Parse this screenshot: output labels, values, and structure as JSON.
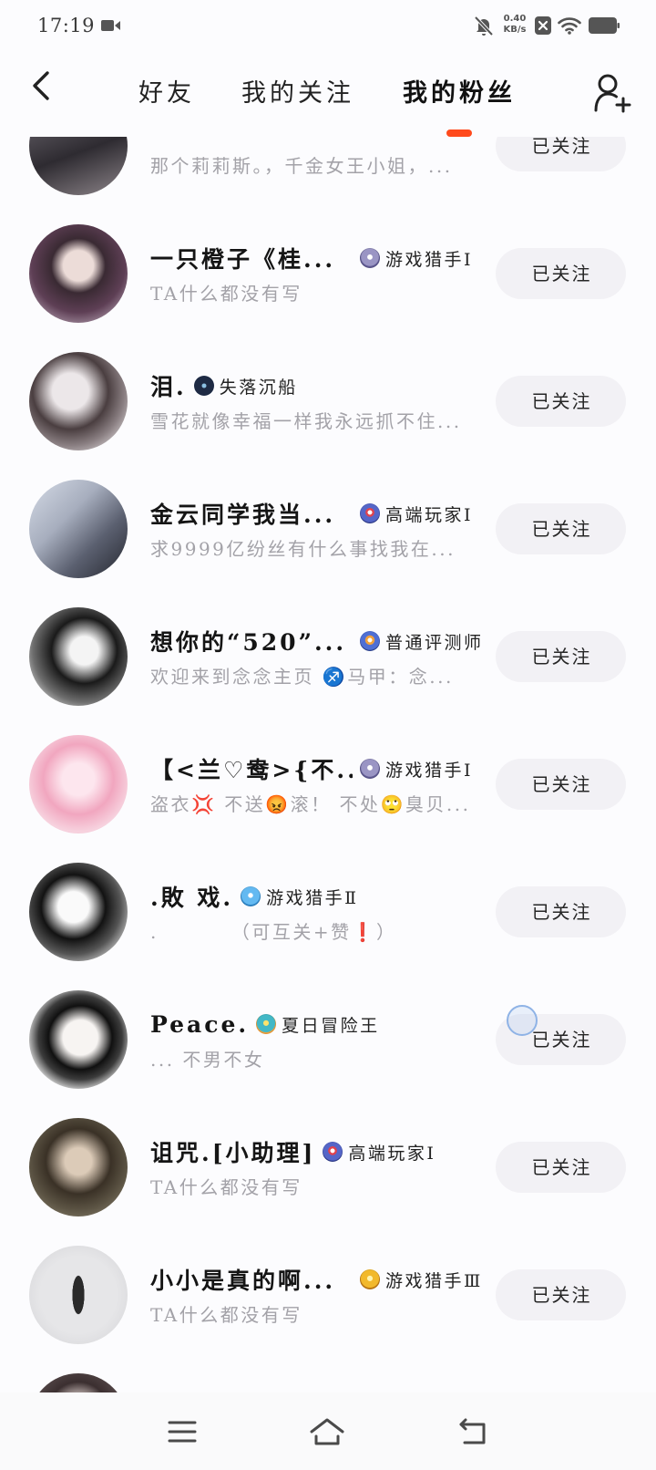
{
  "status_bar": {
    "time": "17:19",
    "net_speed_value": "0.40",
    "net_speed_unit": "KB/s",
    "icons": [
      "video-camera-icon",
      "bell-off-icon",
      "sim-disabled-icon",
      "wifi-icon",
      "battery-icon"
    ]
  },
  "header": {
    "back_icon": "chevron-left-icon",
    "tabs": [
      {
        "label": "好友",
        "selected": false
      },
      {
        "label": "我的关注",
        "selected": false
      },
      {
        "label": "我的粉丝",
        "selected": true
      }
    ],
    "add_icon": "add-user-icon",
    "indicator_color": "#ff4a1c"
  },
  "fans": [
    {
      "bio": "那个莉莉斯。，千金女王小姐，...",
      "button": "已关注"
    },
    {
      "name": "一只橙子《桂...",
      "badge_icon": "game-hunter-badge-icon",
      "badge": "游戏猎手Ⅰ",
      "bio": "TA什么都没有写",
      "button": "已关注"
    },
    {
      "name": "泪.",
      "badge_icon": "lost-shipwreck-badge-icon",
      "badge": "失落沉船",
      "bio": "雪花就像幸福一样我永远抓不住...",
      "button": "已关注"
    },
    {
      "name": "金云同学我当...",
      "badge_icon": "elite-player-badge-icon",
      "badge": "高端玩家Ⅰ",
      "bio": "求9999亿纷丝有什么事找我在...",
      "button": "已关注"
    },
    {
      "name": "想你的“520”...",
      "badge_icon": "reviewer-badge-icon",
      "badge": "普通评测师",
      "bio": "欢迎来到念念主页 ♐马甲：念...",
      "button": "已关注"
    },
    {
      "name": "【<兰♡鸯>{不...",
      "badge_icon": "game-hunter-badge-icon",
      "badge": "游戏猎手Ⅰ",
      "bio": "盗衣💢 不送😡滚！ 不处🙄臭贝...",
      "button": "已关注"
    },
    {
      "name": ".敗 戏.",
      "badge_icon": "game-hunter-badge-icon",
      "badge": "游戏猎手Ⅱ",
      "bio": ".　　　　（可互关+赞❗）",
      "button": "已关注"
    },
    {
      "name": "Peace.",
      "badge_icon": "summer-adventurer-badge-icon",
      "badge": "夏日冒险王",
      "bio": "... 不男不女",
      "button": "已关注"
    },
    {
      "name": "诅咒.[小助理]",
      "badge_icon": "elite-player-badge-icon",
      "badge": "高端玩家Ⅰ",
      "bio": "TA什么都没有写",
      "button": "已关注"
    },
    {
      "name": "小小是真的啊...",
      "badge_icon": "game-hunter-badge-icon",
      "badge": "游戏猎手Ⅲ",
      "bio": "TA什么都没有写",
      "button": "已关注"
    }
  ],
  "nav_bar": {
    "icons": [
      "menu-icon",
      "home-icon",
      "back-icon"
    ]
  }
}
